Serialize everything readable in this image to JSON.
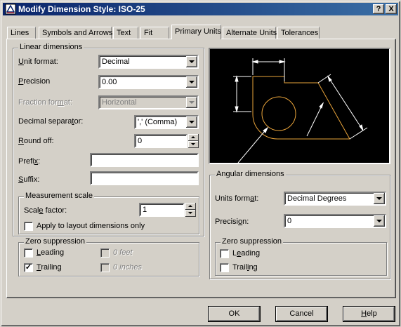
{
  "window": {
    "title": "Modify Dimension Style: ISO-25",
    "help_button": "?",
    "close_button": "X"
  },
  "tabs": [
    {
      "label": "Lines"
    },
    {
      "label": "Symbols and Arrows"
    },
    {
      "label": "Text"
    },
    {
      "label": "Fit"
    },
    {
      "label": "Primary Units"
    },
    {
      "label": "Alternate Units"
    },
    {
      "label": "Tolerances"
    }
  ],
  "active_tab": "Primary Units",
  "linear": {
    "group_label": "Linear dimensions",
    "unit_format": {
      "label_pre": "",
      "label_key": "U",
      "label_post": "nit format:",
      "value": "Decimal"
    },
    "precision": {
      "label_pre": "",
      "label_key": "P",
      "label_post": "recision",
      "value": "0.00"
    },
    "fraction_format": {
      "label_pre": "Fraction for",
      "label_key": "m",
      "label_post": "at:",
      "value": "Horizontal"
    },
    "decimal_separator": {
      "label_pre": "Decimal separa",
      "label_key": "t",
      "label_post": "or:",
      "value": "',' (Comma)"
    },
    "round_off": {
      "label_pre": "",
      "label_key": "R",
      "label_post": "ound off:",
      "value": "0"
    },
    "prefix": {
      "label_pre": "Prefi",
      "label_key": "x",
      "label_post": ":",
      "value": ""
    },
    "suffix": {
      "label_pre": "",
      "label_key": "S",
      "label_post": "uffix:",
      "value": ""
    }
  },
  "measurement": {
    "group_label": "Measurement scale",
    "scale_factor": {
      "label_pre": "Scal",
      "label_key": "e",
      "label_post": " factor:",
      "value": "1"
    },
    "apply_layout": {
      "label": "Apply to layout dimensions only",
      "checked": false
    }
  },
  "zero_linear": {
    "group_label": "Zero suppression",
    "leading": {
      "label_pre": "",
      "label_key": "L",
      "label_post": "eading",
      "checked": false
    },
    "trailing": {
      "label_pre": "",
      "label_key": "T",
      "label_post": "railing",
      "checked": true,
      "mark": "✓"
    },
    "feet": {
      "label": "0 feet",
      "checked": false
    },
    "inches": {
      "label": "0 inches",
      "checked": false
    }
  },
  "angular": {
    "group_label": "Angular dimensions",
    "units_format": {
      "label_pre": "Units form",
      "label_key": "a",
      "label_post": "t:",
      "value": "Decimal Degrees"
    },
    "precision": {
      "label_pre": "Precisi",
      "label_key": "o",
      "label_post": "n:",
      "value": "0"
    }
  },
  "zero_angular": {
    "group_label": "Zero suppression",
    "leading": {
      "label_pre": "L",
      "label_key": "e",
      "label_post": "ading",
      "checked": false
    },
    "trailing": {
      "label_pre": "Trail",
      "label_key": "i",
      "label_post": "ng",
      "checked": false
    }
  },
  "buttons": {
    "ok": "OK",
    "cancel": "Cancel",
    "help_pre": "",
    "help_key": "H",
    "help_post": "elp"
  },
  "colors": {
    "face": "#d4d0c8",
    "title_start": "#0a246a",
    "preview_bg": "#000000",
    "preview_geometry": "#e8a33a",
    "preview_dims": "#ffffff"
  }
}
